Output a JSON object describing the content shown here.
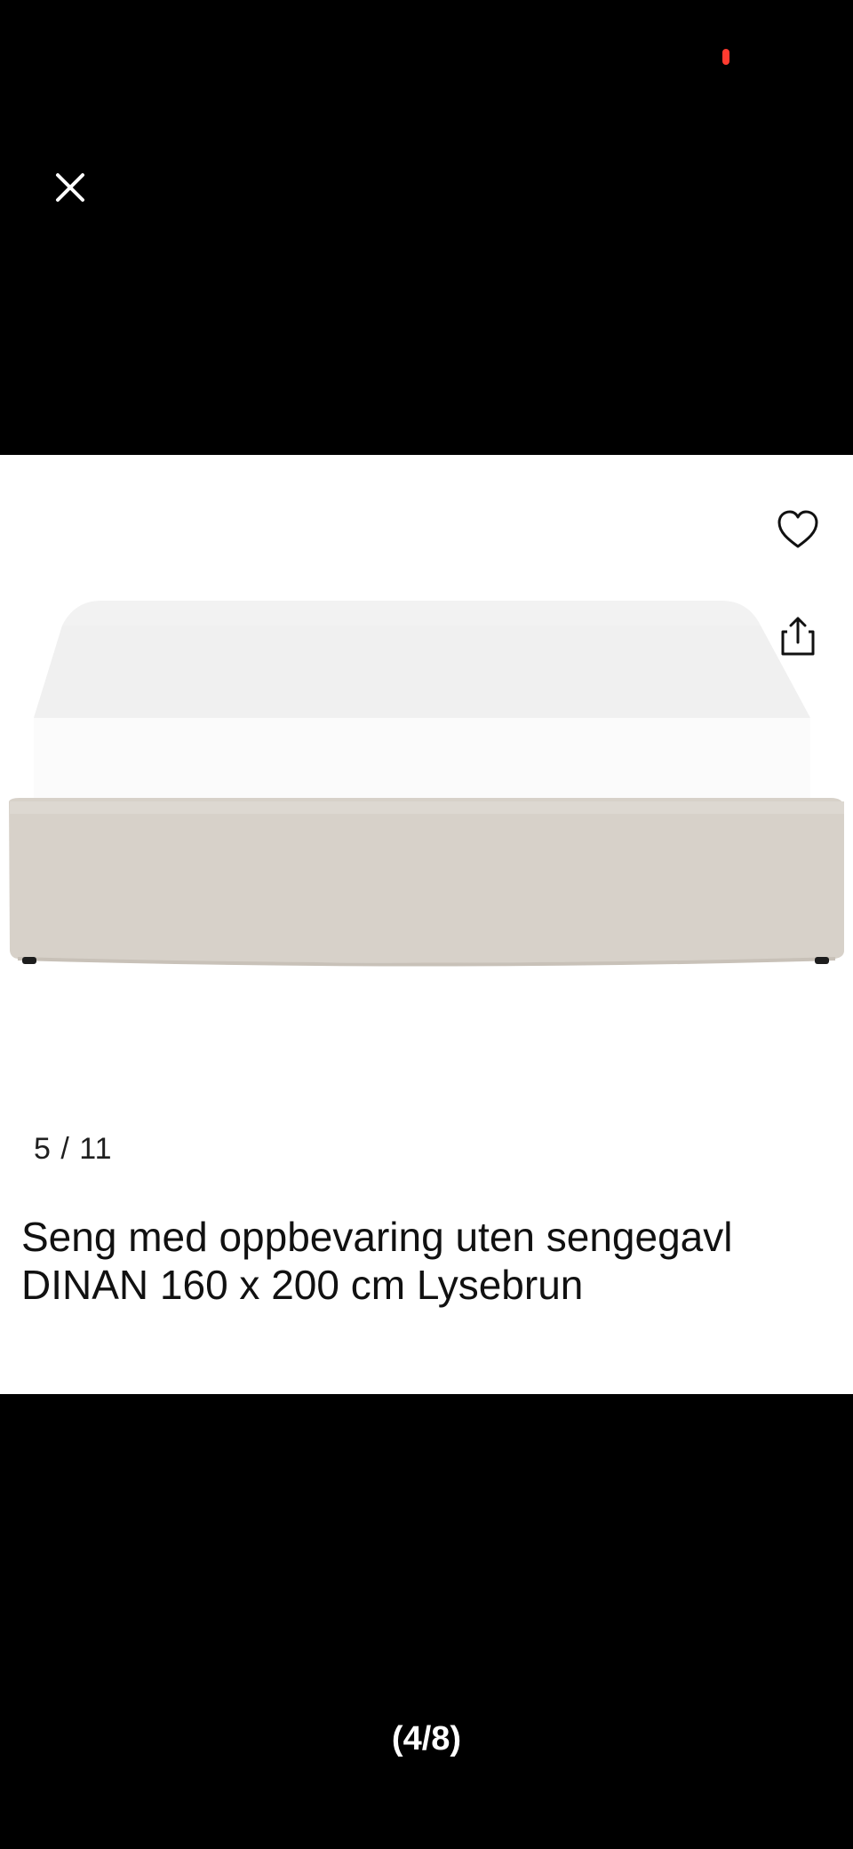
{
  "status": {
    "recording_color": "#ff3b30"
  },
  "viewer": {
    "close_icon": "close-icon",
    "page_count": "(4/8)"
  },
  "product": {
    "image_counter": "5 / 11",
    "title": "Seng med oppbevaring uten sengegavl DINAN 160 x 200 cm Lysebrun",
    "favorite_icon": "heart-icon",
    "share_icon": "share-icon",
    "image_subject": "bed"
  },
  "colors": {
    "background": "#000000",
    "card": "#ffffff",
    "bed_base": "#d7d1c9",
    "mattress": "#f7f7f7"
  }
}
